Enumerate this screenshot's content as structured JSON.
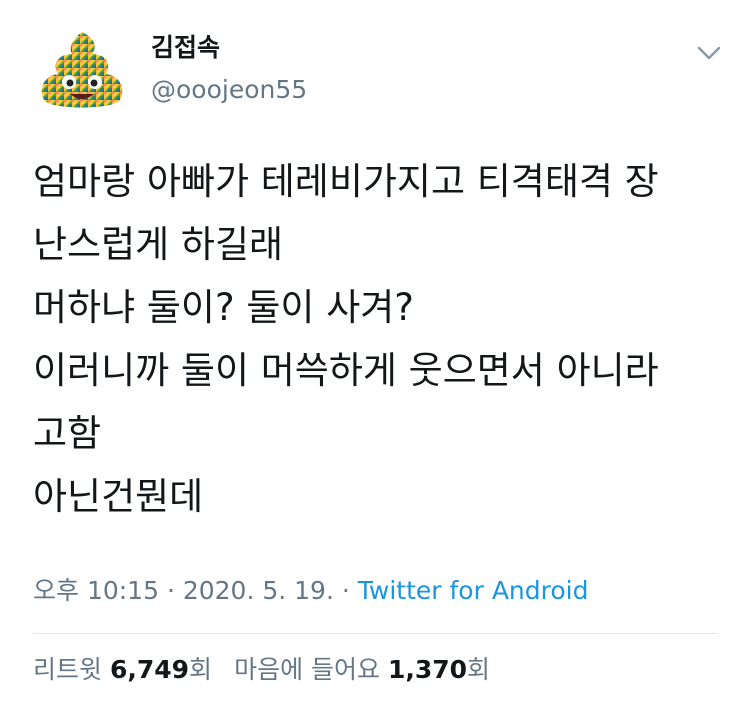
{
  "author": {
    "display_name": "김접속",
    "handle": "@ooojeon55",
    "avatar_icon": "rainbow-poop-emoji-avatar"
  },
  "menu": {
    "icon": "chevron-down-icon"
  },
  "tweet": {
    "lines": [
      "엄마랑 아빠가 테레비가지고 티격태격 장",
      "난스럽게 하길래",
      "머하냐 둘이? 둘이 사겨?",
      "이러니까 둘이 머쓱하게 웃으면서 아니라",
      "고함",
      "아닌건뭔데"
    ]
  },
  "meta": {
    "timestamp": "오후 10:15 · 2020. 5. 19. ·",
    "source": "Twitter for Android"
  },
  "stats": {
    "retweets_label": "리트윗",
    "retweets_count": "6,749",
    "retweets_unit": "회",
    "likes_label": "마음에 들어요",
    "likes_count": "1,370",
    "likes_unit": "회"
  },
  "colors": {
    "text": "#14171a",
    "secondary": "#657786",
    "link": "#1b95e0",
    "divider": "#e1e8ed"
  }
}
